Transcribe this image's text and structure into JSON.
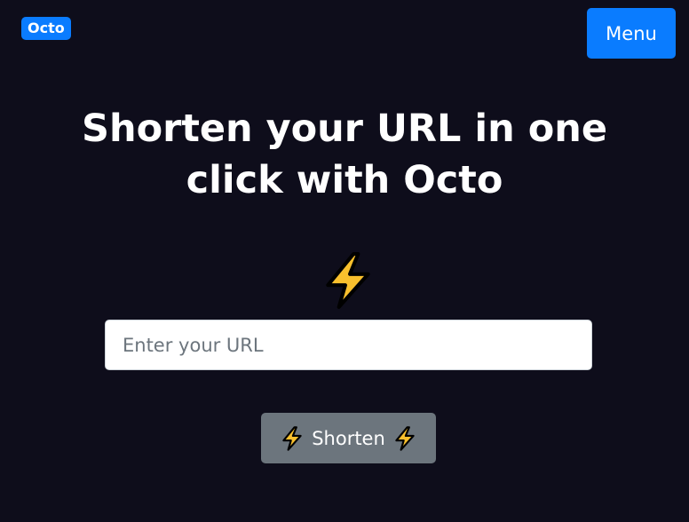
{
  "header": {
    "brand": "Octo",
    "menu_label": "Menu"
  },
  "hero": {
    "title": "Shorten your URL in one click with Octo",
    "icon": "lightning-bolt-icon"
  },
  "form": {
    "url_placeholder": "Enter your URL",
    "url_value": "",
    "submit_label": "Shorten",
    "submit_icon": "lightning-bolt-icon"
  },
  "colors": {
    "background": "#0e0d1b",
    "primary": "#0a7cff",
    "secondary": "#6c757d",
    "bolt_fill": "#f9c02d",
    "bolt_stroke": "#000000"
  }
}
